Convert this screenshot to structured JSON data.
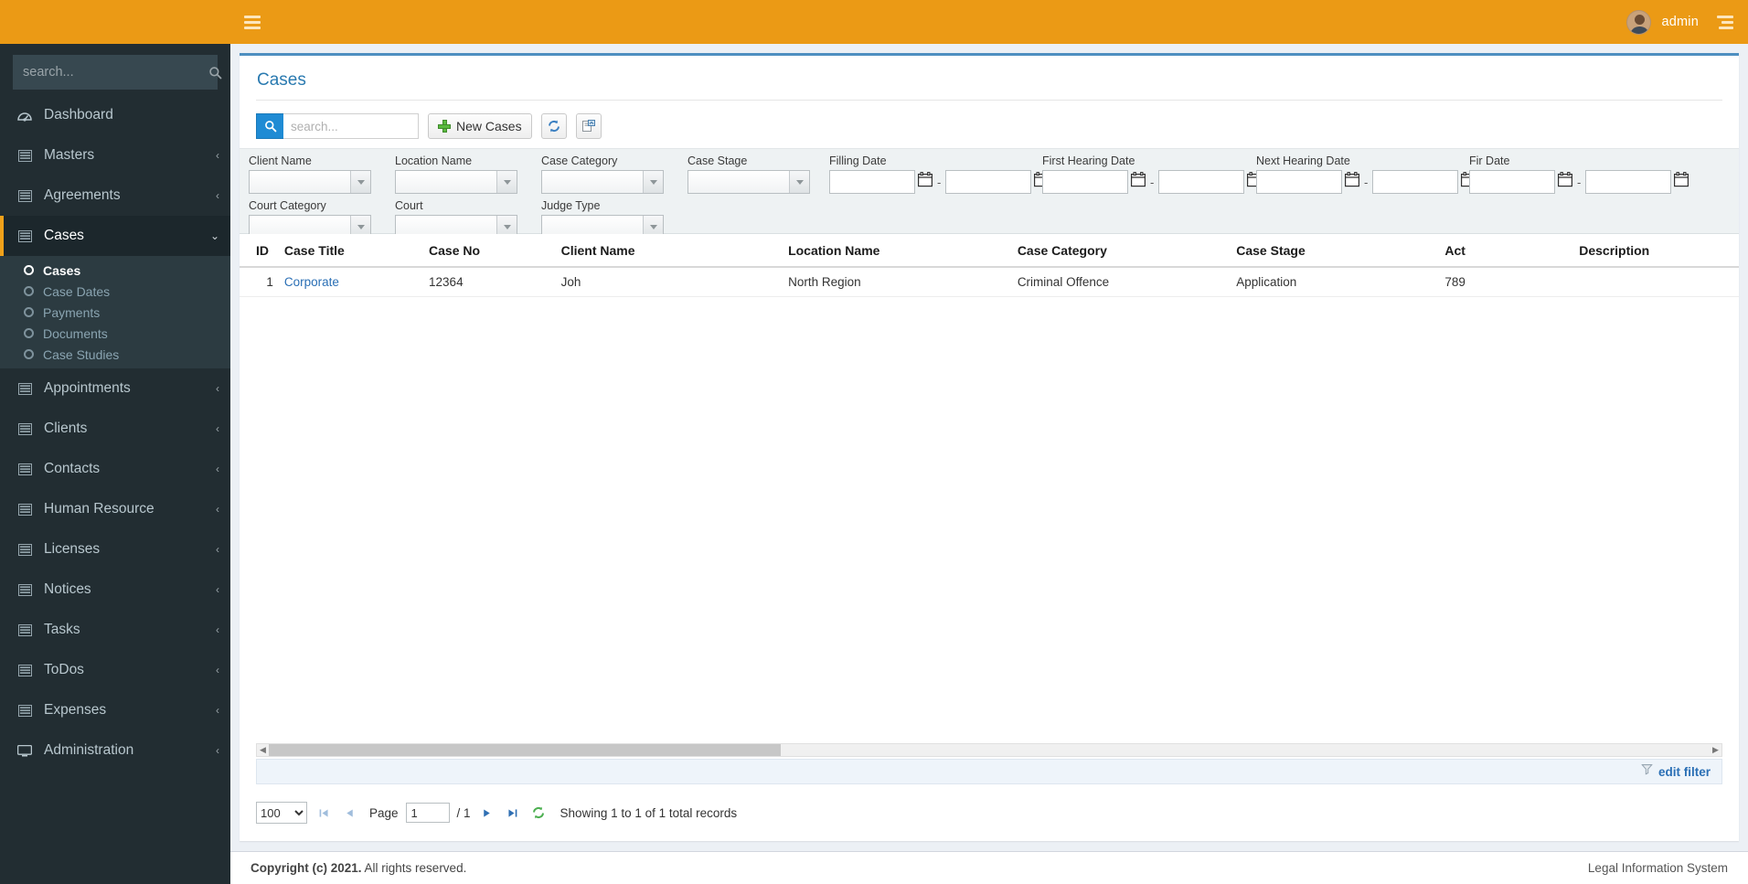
{
  "header": {
    "hamburger_icon": "hamburger-icon",
    "username": "admin",
    "avatar_icon": "avatar-icon",
    "settings_icon": "settings-icon"
  },
  "sidebar": {
    "search_placeholder": "search...",
    "search_icon": "search-icon",
    "items": [
      {
        "label": "Dashboard",
        "icon": "dashboard-icon",
        "caret": "",
        "active": false
      },
      {
        "label": "Masters",
        "icon": "list-icon",
        "caret": "‹",
        "active": false
      },
      {
        "label": "Agreements",
        "icon": "list-icon",
        "caret": "‹",
        "active": false
      },
      {
        "label": "Cases",
        "icon": "list-icon",
        "caret": "⌄",
        "active": true
      },
      {
        "label": "Appointments",
        "icon": "list-icon",
        "caret": "‹",
        "active": false
      },
      {
        "label": "Clients",
        "icon": "list-icon",
        "caret": "‹",
        "active": false
      },
      {
        "label": "Contacts",
        "icon": "list-icon",
        "caret": "‹",
        "active": false
      },
      {
        "label": "Human Resource",
        "icon": "list-icon",
        "caret": "‹",
        "active": false
      },
      {
        "label": "Licenses",
        "icon": "list-icon",
        "caret": "‹",
        "active": false
      },
      {
        "label": "Notices",
        "icon": "list-icon",
        "caret": "‹",
        "active": false
      },
      {
        "label": "Tasks",
        "icon": "list-icon",
        "caret": "‹",
        "active": false
      },
      {
        "label": "ToDos",
        "icon": "list-icon",
        "caret": "‹",
        "active": false
      },
      {
        "label": "Expenses",
        "icon": "list-icon",
        "caret": "‹",
        "active": false
      },
      {
        "label": "Administration",
        "icon": "monitor-icon",
        "caret": "‹",
        "active": false
      }
    ],
    "submenu": [
      {
        "label": "Cases",
        "active": true
      },
      {
        "label": "Case Dates",
        "active": false
      },
      {
        "label": "Payments",
        "active": false
      },
      {
        "label": "Documents",
        "active": false
      },
      {
        "label": "Case Studies",
        "active": false
      }
    ]
  },
  "page": {
    "title": "Cases"
  },
  "toolbar": {
    "search_placeholder": "search...",
    "search_value": "",
    "search_icon": "search-icon",
    "new_button_label": "New Cases",
    "refresh_icon": "refresh-icon",
    "export_icon": "export-icon"
  },
  "filters": {
    "row1": [
      {
        "label": "Client Name",
        "value": "",
        "type": "select"
      },
      {
        "label": "Location Name",
        "value": "",
        "type": "select"
      },
      {
        "label": "Case Category",
        "value": "",
        "type": "select"
      },
      {
        "label": "Case Stage",
        "value": "",
        "type": "select"
      },
      {
        "label": "Filling Date",
        "from": "",
        "to": "",
        "type": "daterange"
      },
      {
        "label": "First Hearing Date",
        "from": "",
        "to": "",
        "type": "daterange"
      },
      {
        "label": "Next Hearing Date",
        "from": "",
        "to": "",
        "type": "daterange"
      },
      {
        "label": "Fir Date",
        "from": "",
        "to": "",
        "type": "daterange"
      }
    ],
    "row2": [
      {
        "label": "Court Category",
        "value": "",
        "type": "select"
      },
      {
        "label": "Court",
        "value": "",
        "type": "select"
      },
      {
        "label": "Judge Type",
        "value": "",
        "type": "select"
      }
    ]
  },
  "table": {
    "columns": [
      "ID",
      "Case Title",
      "Case No",
      "Client Name",
      "Location Name",
      "Case Category",
      "Case Stage",
      "Act",
      "Description"
    ],
    "rows": [
      {
        "id": "1",
        "case_title": "Corporate",
        "case_no": "12364",
        "client_name": "Joh",
        "location_name": "North Region",
        "case_category": "Criminal Offence",
        "case_stage": "Application",
        "act": "789",
        "description": ""
      }
    ]
  },
  "edit_filter": {
    "label": "edit filter",
    "icon": "funnel-icon"
  },
  "pager": {
    "page_size": "100",
    "page_size_options": [
      "100"
    ],
    "first_icon": "first-page-icon",
    "prev_icon": "prev-page-icon",
    "next_icon": "next-page-icon",
    "last_icon": "last-page-icon",
    "refresh_icon": "refresh-icon",
    "page_label": "Page",
    "page_value": "1",
    "page_total": "/ 1",
    "records_text": "Showing 1 to 1 of 1 total records"
  },
  "footer": {
    "copyright_strong": "Copyright (c) 2021.",
    "copyright_rest": " All rights reserved.",
    "right_text": "Legal Information System"
  },
  "colors": {
    "brand_orange": "#eb9a15",
    "sidebar_dark": "#222d32",
    "sidebar_active": "#1c272c",
    "submenu_bg": "#2c3b41",
    "accent_blue": "#2a7ab0",
    "panel_top_border": "#4e8fc0",
    "body_bg": "#ecf0f5"
  }
}
